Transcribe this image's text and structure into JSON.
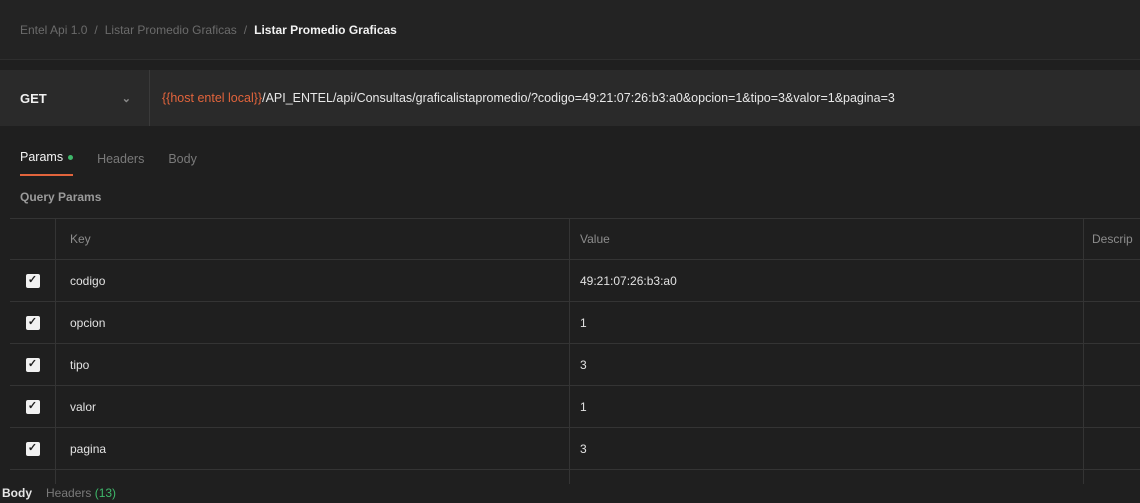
{
  "breadcrumb": {
    "items": [
      "Entel Api 1.0",
      "Listar Promedio Graficas"
    ],
    "current": "Listar Promedio Graficas",
    "separator": "/"
  },
  "request": {
    "method": "GET",
    "url_variable": "{{host entel local}}",
    "url_path": "/API_ENTEL/api/Consultas/graficalistapromedio/?codigo=49:21:07:26:b3:a0&opcion=1&tipo=3&valor=1&pagina=3"
  },
  "tabs": [
    {
      "label": "Params",
      "active": true
    },
    {
      "label": "Headers",
      "active": false
    },
    {
      "label": "Body",
      "active": false
    }
  ],
  "query_params": {
    "label": "Query Params",
    "columns": {
      "key": "Key",
      "value": "Value",
      "description": "Descrip"
    },
    "rows": [
      {
        "key": "codigo",
        "value": "49:21:07:26:b3:a0",
        "checked": true
      },
      {
        "key": "opcion",
        "value": "1",
        "checked": true
      },
      {
        "key": "tipo",
        "value": "3",
        "checked": true
      },
      {
        "key": "valor",
        "value": "1",
        "checked": true
      },
      {
        "key": "pagina",
        "value": "3",
        "checked": true
      }
    ]
  },
  "response_tabs": {
    "body": "Body",
    "headers": "Headers",
    "headers_count": "(13)"
  },
  "colors": {
    "accent": "#e2643c",
    "success": "#3fb86b",
    "background": "#1f1f1f"
  }
}
